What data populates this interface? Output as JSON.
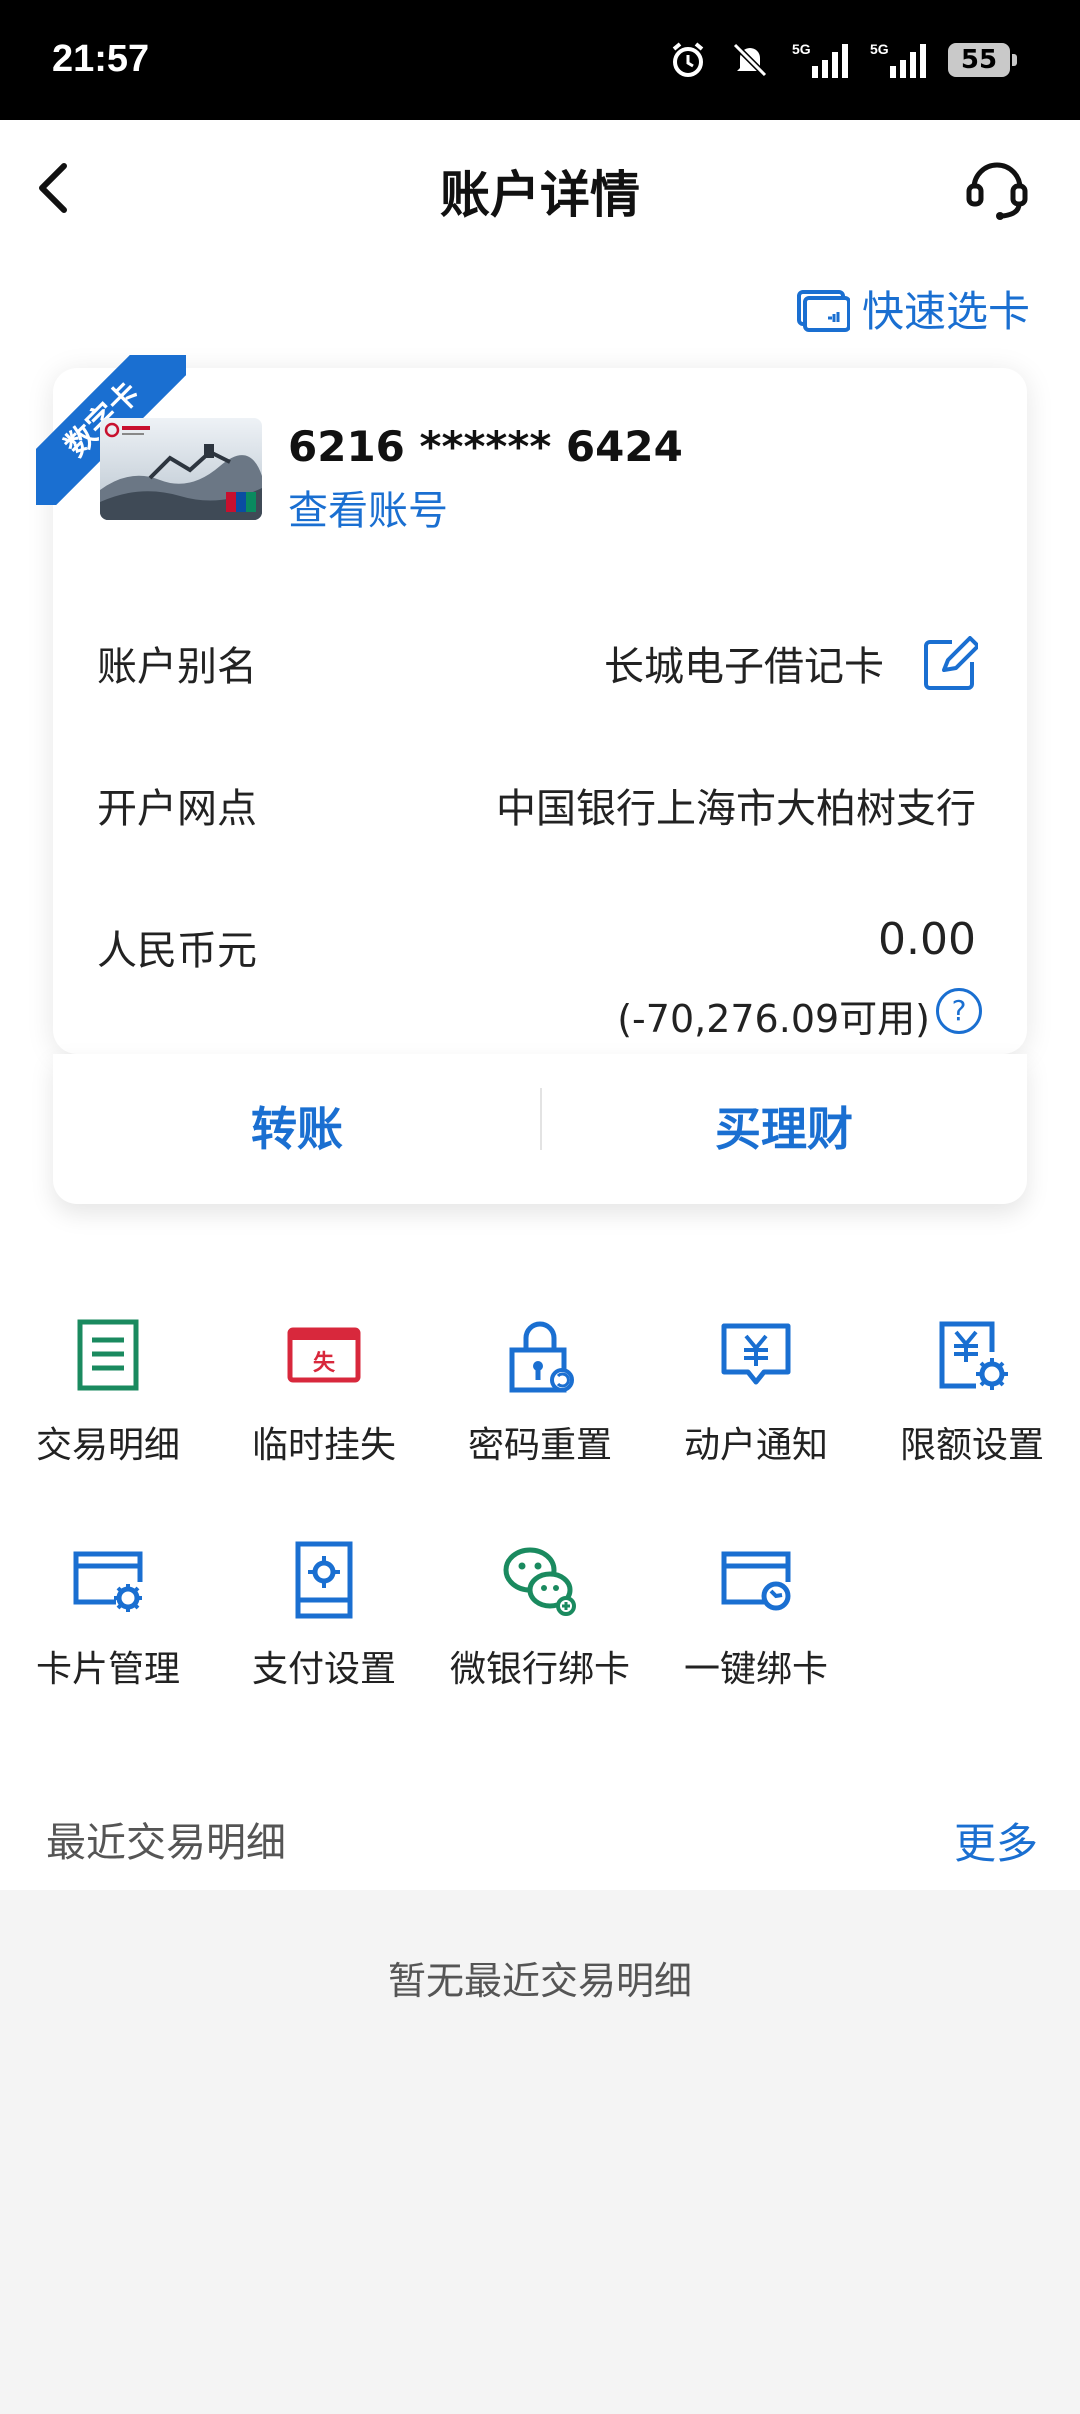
{
  "status_bar": {
    "time": "21:57",
    "battery": "55",
    "net1": "5G",
    "net2": "5G"
  },
  "header": {
    "title": "账户详情"
  },
  "quick_select": {
    "label": "快速选卡"
  },
  "card": {
    "badge": "数字卡",
    "number": "6216 ****** 6424",
    "view_number": "查看账号",
    "rows": [
      {
        "label": "账户别名",
        "value": "长城电子借记卡"
      },
      {
        "label": "开户网点",
        "value": "中国银行上海市大柏树支行"
      },
      {
        "label": "人民币元",
        "value": "0.00"
      }
    ],
    "available": "(-70,276.09可用)",
    "help": "?"
  },
  "actions": {
    "transfer": "转账",
    "wealth": "买理财"
  },
  "features": [
    {
      "label": "交易明细",
      "icon": "list-icon"
    },
    {
      "label": "临时挂失",
      "icon": "loss-report-icon"
    },
    {
      "label": "密码重置",
      "icon": "lock-reset-icon"
    },
    {
      "label": "动户通知",
      "icon": "yuan-notify-icon"
    },
    {
      "label": "限额设置",
      "icon": "yuan-settings-icon"
    },
    {
      "label": "卡片管理",
      "icon": "card-settings-icon"
    },
    {
      "label": "支付设置",
      "icon": "payment-settings-icon"
    },
    {
      "label": "微银行绑卡",
      "icon": "wechat-icon"
    },
    {
      "label": "一键绑卡",
      "icon": "card-bind-icon"
    }
  ],
  "recent": {
    "title": "最近交易明细",
    "more": "更多",
    "empty": "暂无最近交易明细"
  },
  "colors": {
    "accent": "#1a6fd1",
    "green": "#1a8a5f",
    "red": "#d8283c"
  }
}
